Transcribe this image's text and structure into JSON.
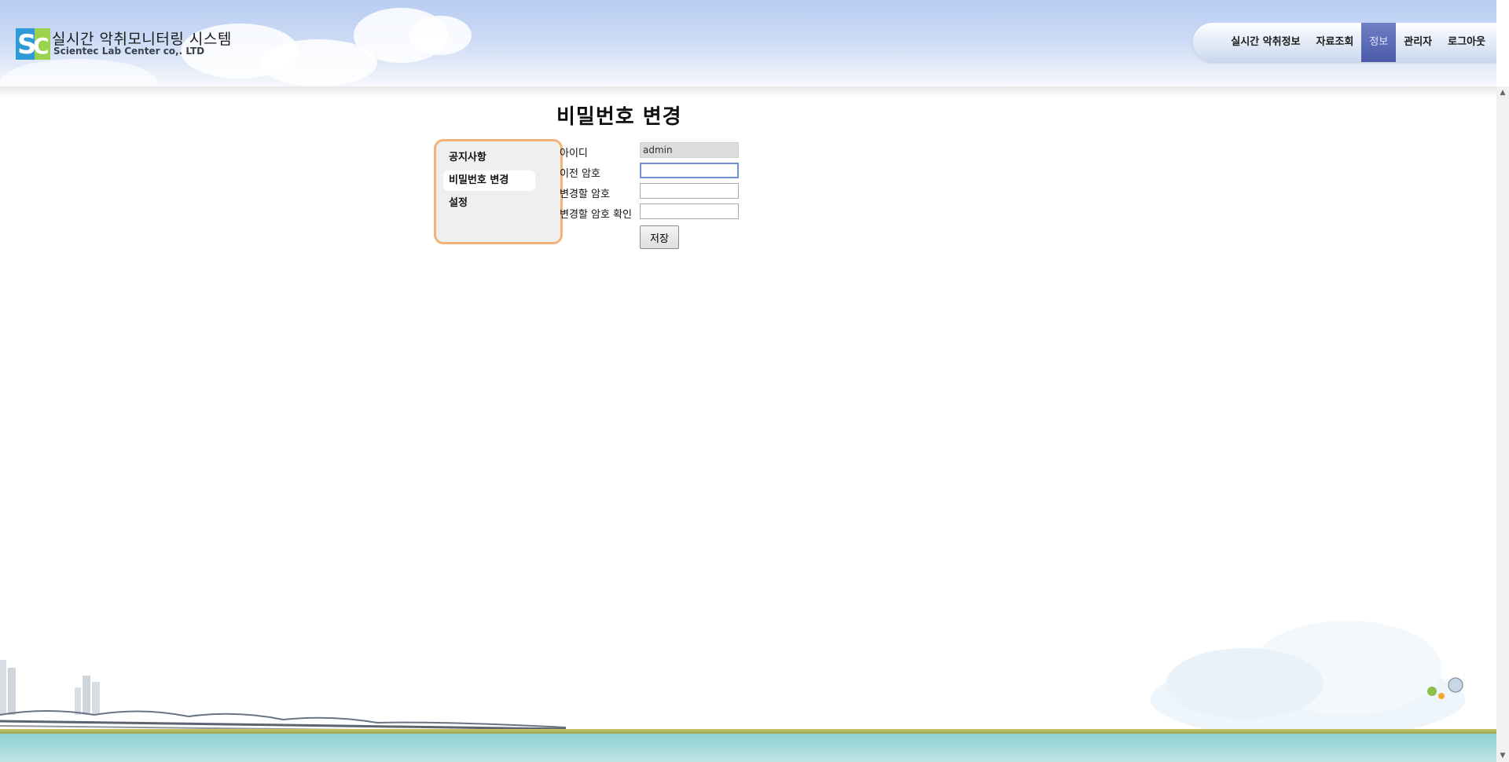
{
  "brand": {
    "title": "실시간 악취모니터링 시스템",
    "subtitle": "Scientec Lab Center co,. LTD",
    "logo_icon": "slc-logo-icon"
  },
  "nav": {
    "items": [
      {
        "label": "실시간 악취정보",
        "active": false
      },
      {
        "label": "자료조회",
        "active": false
      },
      {
        "label": "정보",
        "active": true
      },
      {
        "label": "관리자",
        "active": false
      },
      {
        "label": "로그아웃",
        "active": false
      }
    ]
  },
  "page": {
    "title": "비밀번호 변경"
  },
  "side_menu": {
    "items": [
      {
        "label": "공지사항",
        "active": false
      },
      {
        "label": "비밀번호 변경",
        "active": true
      },
      {
        "label": "설정",
        "active": false
      }
    ]
  },
  "form": {
    "id_label": "아이디",
    "id_value": "admin",
    "old_password_label": "이전 암호",
    "old_password_value": "",
    "new_password_label": "변경할 암호",
    "new_password_value": "",
    "confirm_password_label": "변경할 암호 확인",
    "confirm_password_value": "",
    "save_label": "저장"
  },
  "colors": {
    "nav_active": "#4a5aa8",
    "side_border": "#f4b377"
  }
}
